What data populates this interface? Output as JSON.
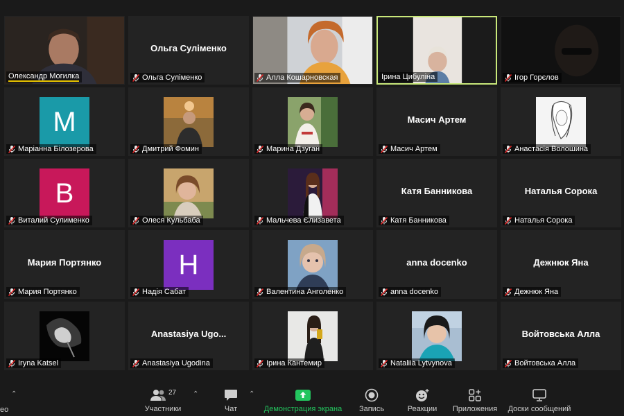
{
  "participants": [
    {
      "name": "Олександр Могилка",
      "type": "video1",
      "muted": false,
      "speaking": true
    },
    {
      "name": "Ольга Суліменко",
      "type": "name",
      "display": "Ольга Суліменко",
      "muted": true
    },
    {
      "name": "Алла Кошарновская",
      "type": "video2",
      "muted": true
    },
    {
      "name": "Ірина Цибуліна",
      "type": "video3",
      "muted": false,
      "active": true
    },
    {
      "name": "Ігор Горєлов",
      "type": "video4",
      "muted": true
    },
    {
      "name": "Маріанна Білозерова",
      "type": "letter",
      "letter": "M",
      "color": "#1a9aa8",
      "muted": true
    },
    {
      "name": "Дмитрий Фомин",
      "type": "photo",
      "photo": "p1",
      "muted": true
    },
    {
      "name": "Марина Дзуган",
      "type": "photo",
      "photo": "p2",
      "muted": true
    },
    {
      "name": "Масич Артем",
      "type": "name",
      "display": "Масич Артем",
      "muted": true
    },
    {
      "name": "Анастасія Волошина",
      "type": "photo",
      "photo": "p3",
      "muted": true
    },
    {
      "name": "Виталий Сулименко",
      "type": "letter",
      "letter": "B",
      "color": "#c8185a",
      "muted": true
    },
    {
      "name": "Олеся Кульбаба",
      "type": "photo",
      "photo": "p4",
      "muted": true
    },
    {
      "name": "Мальчева Єлизавета",
      "type": "photo",
      "photo": "p5",
      "muted": true
    },
    {
      "name": "Катя Банникова",
      "type": "name",
      "display": "Катя Банникова",
      "muted": true
    },
    {
      "name": "Наталья Сорока",
      "type": "name",
      "display": "Наталья Сорока",
      "muted": true
    },
    {
      "name": "Мария Портянко",
      "type": "name",
      "display": "Мария Портянко",
      "muted": true
    },
    {
      "name": "Надія Сабат",
      "type": "letter",
      "letter": "H",
      "color": "#7b2fbf",
      "muted": true
    },
    {
      "name": "Валентина Анголенко",
      "type": "photo",
      "photo": "p6",
      "muted": true
    },
    {
      "name": "anna docenko",
      "type": "name",
      "display": "anna docenko",
      "muted": true
    },
    {
      "name": "Дежнюк Яна",
      "type": "name",
      "display": "Дежнюк Яна",
      "muted": true
    },
    {
      "name": "Iryna Katsel",
      "type": "photo",
      "photo": "p7",
      "muted": true
    },
    {
      "name": "Anastasiya Ugodina",
      "type": "name",
      "display": "Anastasiya Ugo...",
      "muted": true
    },
    {
      "name": "Ірина Кантемир",
      "type": "photo",
      "photo": "p8",
      "muted": true
    },
    {
      "name": "Nataliia Lytvynova",
      "type": "photo",
      "photo": "p9",
      "muted": true
    },
    {
      "name": "Войтовська Алла",
      "type": "name",
      "display": "Войтовська Алла",
      "muted": true
    }
  ],
  "toolbar": {
    "video_partial": "ео",
    "participants_label": "Участники",
    "participants_count": "27",
    "chat_label": "Чат",
    "share_label": "Демонстрация экрана",
    "record_label": "Запись",
    "reactions_label": "Реакции",
    "apps_label": "Приложения",
    "whiteboard_label": "Доски сообщений"
  },
  "colors": {
    "share_green": "#23c55e",
    "active_border": "#c9e87a",
    "mute_red": "#e02828"
  }
}
